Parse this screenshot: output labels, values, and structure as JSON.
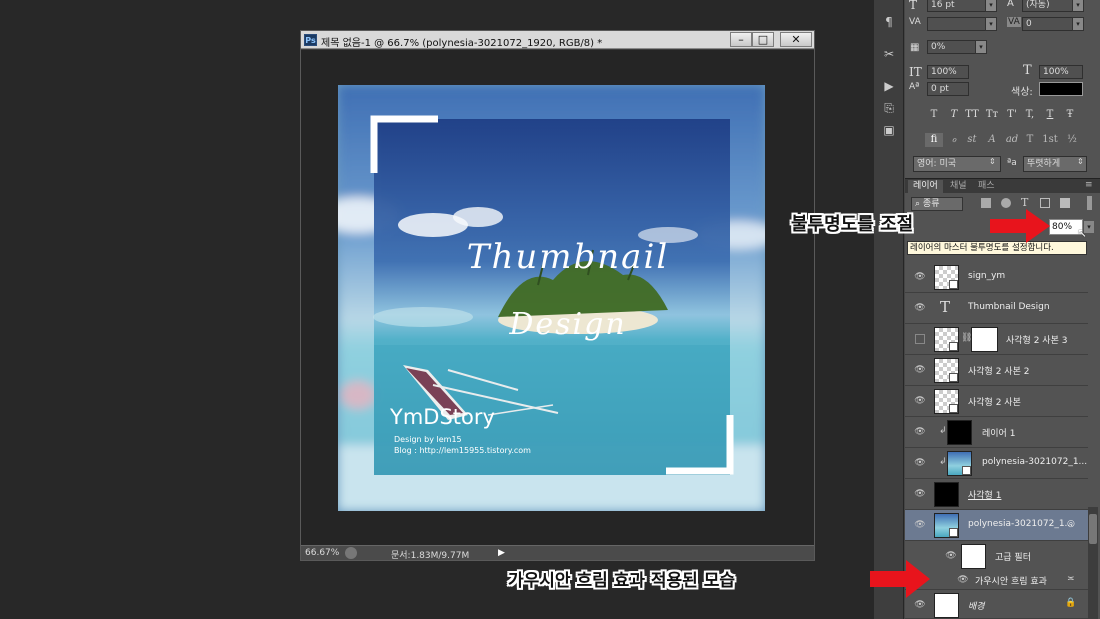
{
  "document": {
    "ps_badge": "Ps",
    "title": "제목 없음-1 @ 66.7% (polynesia-3021072_1920, RGB/8) *",
    "minimize": "–",
    "maximize": "□",
    "close": "✕",
    "zoom": "66.67%",
    "doc_size": "문서:1.83M/9.77M",
    "artwork": {
      "title_line1": "Thumbnail",
      "title_line2": "Design",
      "logo": "YmDStory",
      "credit": "Design by lem15",
      "blog": "Blog : http://lem15955.tistory.com"
    }
  },
  "character_panel": {
    "font_size": "16 pt",
    "leading": "(자동)",
    "tracking": "0",
    "scale_percent": "0%",
    "vertical_scale": "100%",
    "horizontal_scale": "100%",
    "baseline": "0 pt",
    "color_label": "색상:",
    "style_buttons": [
      "T",
      "T",
      "TT",
      "Tт",
      "T'",
      "T,",
      "T",
      "Ŧ"
    ],
    "opentype_buttons": [
      "fi",
      "ℴ",
      "st",
      "A",
      "ad",
      "T",
      "1st",
      "½"
    ],
    "language": "영어: 미국",
    "aa_label": "ªa",
    "antialias": "뚜렷하게"
  },
  "layers_panel": {
    "tabs": [
      "레이어",
      "채널",
      "패스"
    ],
    "filter_kind": "종류",
    "opacity_value": "80%",
    "tooltip": "레이어의 마스터 불투명도를 설정합니다.",
    "layers": [
      {
        "name": "sign_ym",
        "type": "smart"
      },
      {
        "name": "Thumbnail Design",
        "type": "text"
      },
      {
        "name": "사각형 2 사본 3",
        "type": "masked",
        "hidden": true
      },
      {
        "name": "사각형 2 사본 2",
        "type": "smart"
      },
      {
        "name": "사각형 2 사본",
        "type": "smart"
      },
      {
        "name": "레이어 1",
        "type": "black-clipped"
      },
      {
        "name": "polynesia-3021072_1...",
        "type": "photo-clipped"
      },
      {
        "name": "사각형 1",
        "type": "black"
      },
      {
        "name": "polynesia-3021072_1...",
        "type": "photo",
        "selected": true
      },
      {
        "name": "고급 필터",
        "type": "filter-mask"
      },
      {
        "name": "가우시안 흐림 효과",
        "type": "filter"
      },
      {
        "name": "배경",
        "type": "background"
      }
    ]
  },
  "annotations": {
    "opacity": "불투명도를 조절",
    "gaussian": "가우시안 흐림 효과 적용된 모습"
  },
  "colors": {
    "accent_red": "#e8141c",
    "selected_layer": "#6c7a91",
    "panel_bg": "#535353"
  }
}
